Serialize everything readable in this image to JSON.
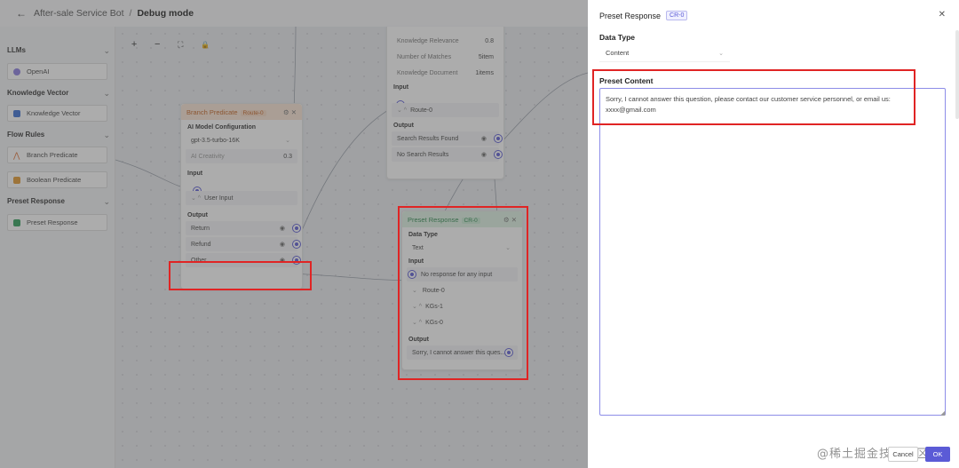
{
  "header": {
    "back_icon": "←",
    "crumb_app": "After-sale Service Bot",
    "separator": "/",
    "crumb_mode": "Debug mode"
  },
  "sidebar": {
    "sections": [
      {
        "title": "LLMs",
        "items": [
          {
            "label": "OpenAI",
            "icon": "openai-icon",
            "color": "#8b7de0"
          }
        ]
      },
      {
        "title": "Knowledge Vector",
        "items": [
          {
            "label": "Knowledge Vector",
            "icon": "knowledge-vector-icon",
            "color": "#3b6fd4"
          }
        ]
      },
      {
        "title": "Flow Rules",
        "items": [
          {
            "label": "Branch Predicate",
            "icon": "branch-icon",
            "color": "#e0743a"
          },
          {
            "label": "Boolean Predicate",
            "icon": "boolean-icon",
            "color": "#e39a2e"
          }
        ]
      },
      {
        "title": "Preset Response",
        "items": [
          {
            "label": "Preset Response",
            "icon": "preset-response-icon",
            "color": "#2f9e5a"
          }
        ]
      }
    ],
    "chevron": "⌄"
  },
  "toolbar": {
    "zoom_in": "+",
    "zoom_out": "−",
    "fit": "⛶",
    "lock": "🔒"
  },
  "branch_node": {
    "title": "Branch Predicate",
    "badge": "Route-0",
    "model_label": "AI Model Configuration",
    "model_value": "gpt-3.5-turbo-16K",
    "creativity_label": "AI Creativity",
    "creativity_value": "0.3",
    "input_label": "Input",
    "input_row": "User Input",
    "output_label": "Output",
    "outputs": [
      "Return",
      "Refund",
      "Other"
    ]
  },
  "kb_node": {
    "rows": [
      {
        "label": "Knowledge Relevance",
        "value": "0.8"
      },
      {
        "label": "Number of Matches",
        "value": "5item"
      },
      {
        "label": "Knowledge Document",
        "value": "1items"
      }
    ],
    "input_label": "Input",
    "input_row": "Route-0",
    "output_label": "Output",
    "outputs": [
      "Search Results Found",
      "No Search Results"
    ]
  },
  "preset_node": {
    "title": "Preset Response",
    "badge": "CR-0",
    "type_label": "Data Type",
    "type_value": "Text",
    "input_label": "Input",
    "inputs": [
      "No response for any input",
      "Route-0",
      "KGs-1",
      "KGs-0"
    ],
    "output_label": "Output",
    "output_value": "Sorry, I cannot answer this ques..."
  },
  "drawer": {
    "title": "Preset Response",
    "badge": "CR-0",
    "close_icon": "✕",
    "data_type_label": "Data Type",
    "data_type_value": "Content",
    "preset_content_label": "Preset Content",
    "preset_content_value": "Sorry, I cannot answer this question, please contact our customer service personnel, or email us: xxxx@gmail.com",
    "cancel_label": "Cancel",
    "ok_label": "OK"
  },
  "watermark": "@稀土掘金技术社区",
  "colors": {
    "accent": "#5b5bd6",
    "highlight": "#e02424",
    "branch_head": "#fbe6d6",
    "preset_head": "#dff3e4"
  }
}
